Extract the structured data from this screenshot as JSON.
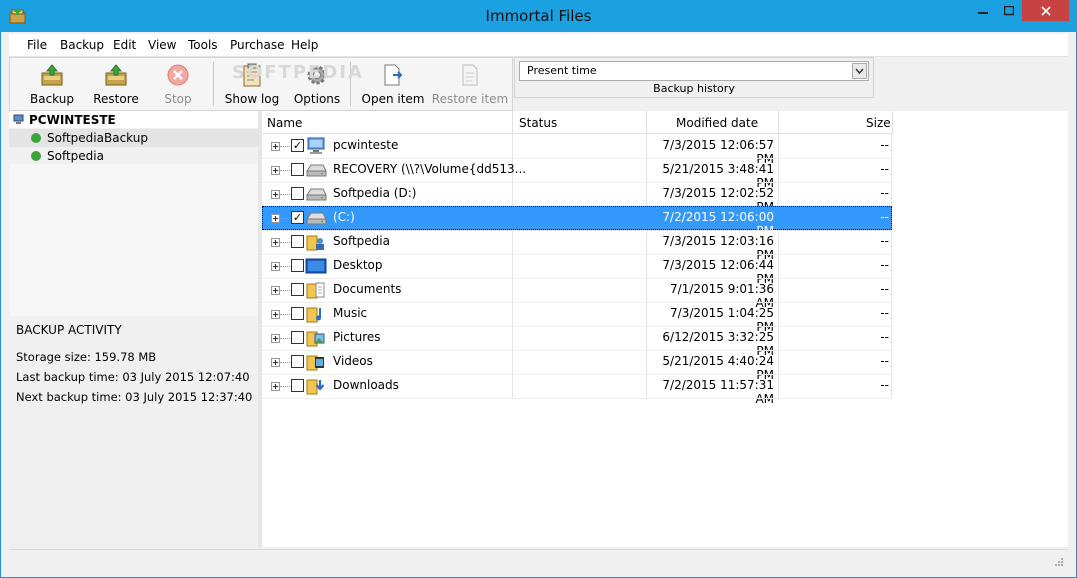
{
  "window": {
    "title": "Immortal Files"
  },
  "menu": [
    "File",
    "Backup",
    "Edit",
    "View",
    "Tools",
    "Purchase",
    "Help"
  ],
  "toolbar": {
    "backup": "Backup",
    "restore": "Restore",
    "stop": "Stop",
    "show_log": "Show log",
    "options": "Options",
    "open_item": "Open item",
    "restore_item": "Restore item"
  },
  "history": {
    "value": "Present time",
    "label": "Backup history"
  },
  "watermark": "SOFTPEDIA",
  "tree": {
    "root": "PCWINTESTE",
    "children": [
      "SoftpediaBackup",
      "Softpedia"
    ]
  },
  "activity": {
    "title": "BACKUP ACTIVITY",
    "storage": "Storage size: 159.78 MB",
    "last": "Last backup time: 03 July 2015 12:07:40",
    "next": "Next backup time: 03 July 2015 12:37:40"
  },
  "columns": {
    "name": "Name",
    "status": "Status",
    "modified": "Modified date",
    "size": "Size"
  },
  "rows": [
    {
      "name": "pcwinteste",
      "status": "",
      "modified": "7/3/2015 12:06:57 PM",
      "size": "--",
      "checked": "✓",
      "icon": "computer-icon"
    },
    {
      "name": "RECOVERY (\\\\?\\Volume{dd513...",
      "status": "",
      "modified": "5/21/2015 3:48:41 PM",
      "size": "--",
      "checked": "",
      "icon": "drive-icon"
    },
    {
      "name": "Softpedia (D:)",
      "status": "",
      "modified": "7/3/2015 12:02:52 PM",
      "size": "--",
      "checked": "",
      "icon": "drive-icon"
    },
    {
      "name": "(C:)",
      "status": "",
      "modified": "7/2/2015 12:06:00 PM",
      "size": "--",
      "checked": "✓",
      "icon": "drive-icon"
    },
    {
      "name": "Softpedia",
      "status": "",
      "modified": "7/3/2015 12:03:16 PM",
      "size": "--",
      "checked": "",
      "icon": "user-folder-icon"
    },
    {
      "name": "Desktop",
      "status": "",
      "modified": "7/3/2015 12:06:44 PM",
      "size": "--",
      "checked": "",
      "icon": "desktop-icon"
    },
    {
      "name": "Documents",
      "status": "",
      "modified": "7/1/2015 9:01:36 AM",
      "size": "--",
      "checked": "",
      "icon": "documents-folder-icon"
    },
    {
      "name": "Music",
      "status": "",
      "modified": "7/3/2015 1:04:25 PM",
      "size": "--",
      "checked": "",
      "icon": "music-folder-icon"
    },
    {
      "name": "Pictures",
      "status": "",
      "modified": "6/12/2015 3:32:25 PM",
      "size": "--",
      "checked": "",
      "icon": "pictures-folder-icon"
    },
    {
      "name": "Videos",
      "status": "",
      "modified": "5/21/2015 4:40:24 PM",
      "size": "--",
      "checked": "",
      "icon": "videos-folder-icon"
    },
    {
      "name": "Downloads",
      "status": "",
      "modified": "7/2/2015 11:57:31 AM",
      "size": "--",
      "checked": "",
      "icon": "downloads-folder-icon"
    }
  ],
  "colors": {
    "titlebar": "#1ba1e2",
    "selection": "#3399ff",
    "close": "#c74343",
    "status_ok": "#3aa43a"
  }
}
